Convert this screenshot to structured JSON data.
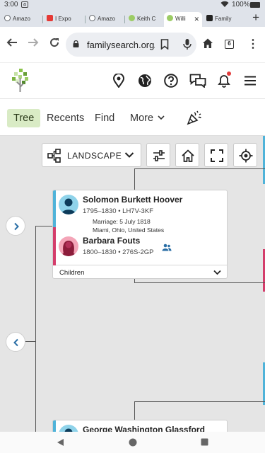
{
  "status_bar": {
    "time": "3:00",
    "notification_badge": "a",
    "battery": "100%"
  },
  "tabs": [
    {
      "label": "Amazo",
      "favicon_color": "#5f6368"
    },
    {
      "label": "I Expo",
      "favicon_color": "#e53935"
    },
    {
      "label": "Amazo",
      "favicon_color": "#5f6368"
    },
    {
      "label": "Keith C",
      "favicon_color": "#8bc34a"
    },
    {
      "label": "Willi",
      "favicon_color": "#8bc34a",
      "active": true
    },
    {
      "label": "Family",
      "favicon_color": "#222222"
    }
  ],
  "new_tab_label": "+",
  "address_bar": {
    "url": "familysearch.org/",
    "tab_count": "6"
  },
  "header_icons": [
    "map-pin-icon",
    "globe-icon",
    "help-icon",
    "chat-icon",
    "bell-icon",
    "menu-icon"
  ],
  "sub_nav": {
    "tree": "Tree",
    "recents": "Recents",
    "find": "Find",
    "more": "More"
  },
  "toolbar": {
    "layout_label": "LANDSCAPE"
  },
  "couple1": {
    "husband": {
      "name": "Solomon Burkett Hoover",
      "meta": "1795–1830 • LH7V-3KF"
    },
    "marriage_line1": "Marriage: 5 July 1818",
    "marriage_line2": "Miami, Ohio, United States",
    "wife": {
      "name": "Barbara Fouts",
      "meta": "1800–1830 • 276S-2GP"
    },
    "children_label": "Children"
  },
  "couple2": {
    "husband": {
      "name": "George Washington Glassford"
    }
  },
  "colors": {
    "male": "#4fb3d9",
    "female": "#d43d6b",
    "active_nav": "#d9ebc5"
  }
}
